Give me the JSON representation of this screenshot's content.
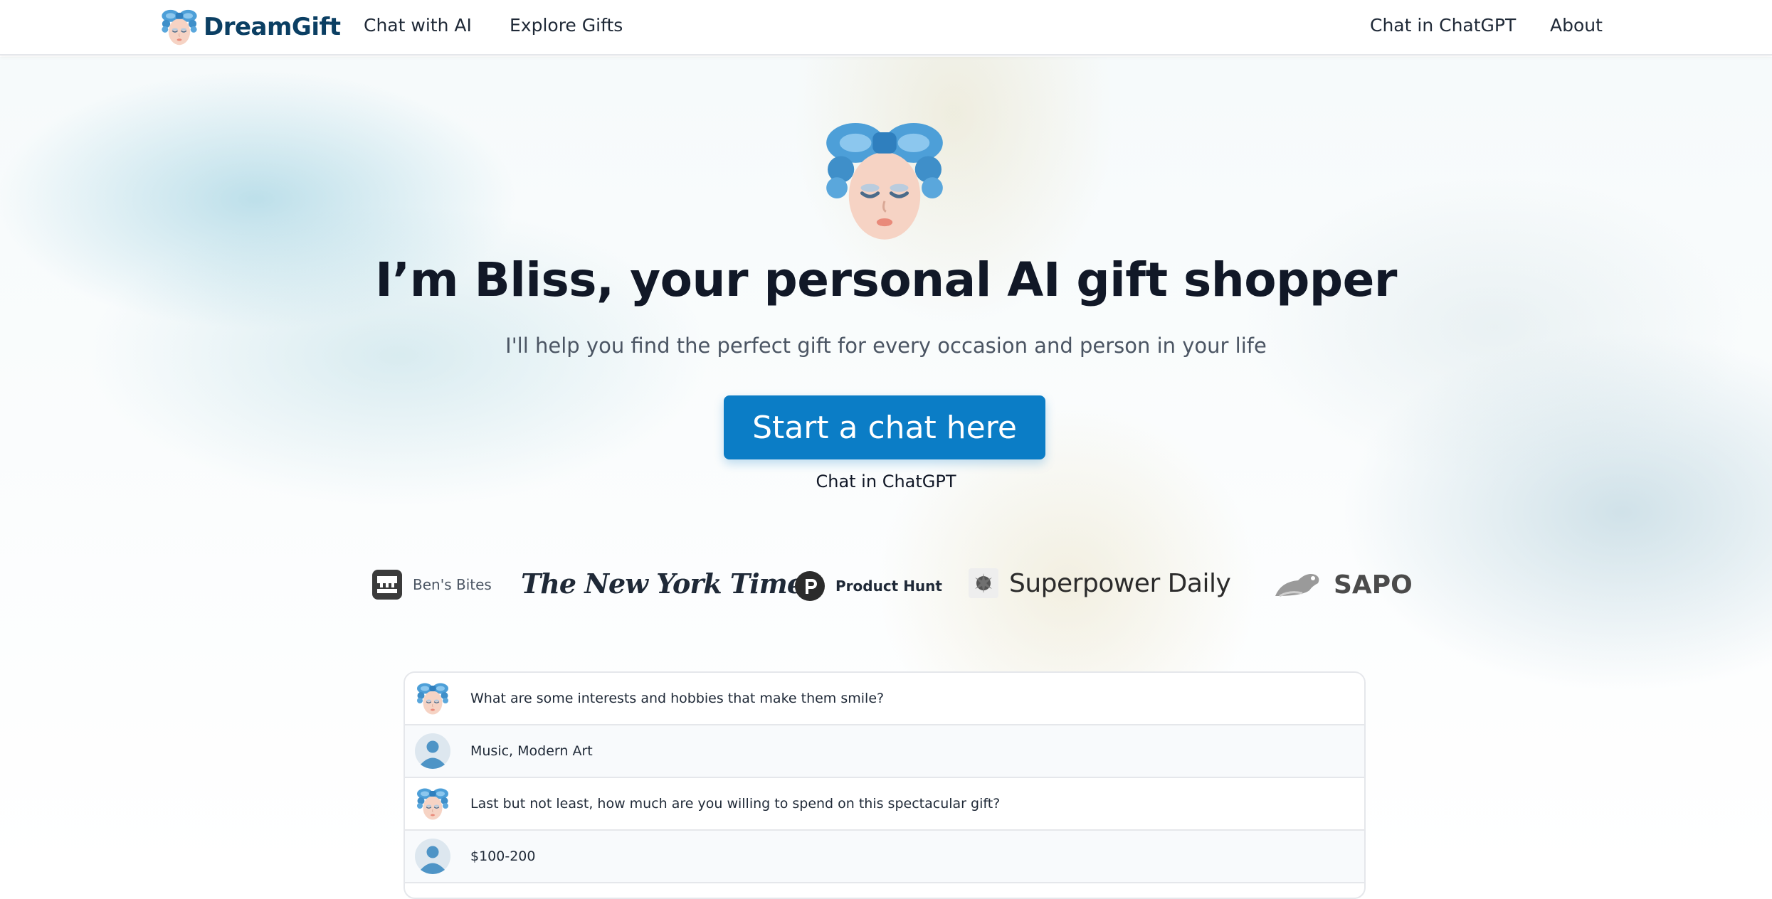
{
  "navbar": {
    "brand_name": "DreamGift",
    "links": {
      "chat_with_ai": "Chat with AI",
      "explore_gifts": "Explore Gifts",
      "chat_in_chatgpt": "Chat in ChatGPT",
      "about": "About"
    }
  },
  "hero": {
    "title": "I’m Bliss, your personal AI gift shopper",
    "subtitle": "I'll help you find the perfect gift for every occasion and person in your life",
    "cta_label": "Start a chat here",
    "secondary_link": "Chat in ChatGPT"
  },
  "press": {
    "bens_bites": "Ben's Bites",
    "nyt": "The New York Times",
    "product_hunt": "Product Hunt",
    "superpower_daily": "Superpower Daily",
    "sapo": "SAPO"
  },
  "chat_preview": {
    "messages": [
      {
        "role": "bot",
        "text": "What are some interests and hobbies that make them smile?"
      },
      {
        "role": "user",
        "text": "Music, Modern Art"
      },
      {
        "role": "bot",
        "text": "Last but not least, how much are you willing to spend on this spectacular gift?"
      },
      {
        "role": "user",
        "text": "$100-200"
      }
    ]
  },
  "colors": {
    "brand": "#0b3f63",
    "accent": "#0b7dc6",
    "bow": "#5aa7dc",
    "text": "#111827"
  }
}
